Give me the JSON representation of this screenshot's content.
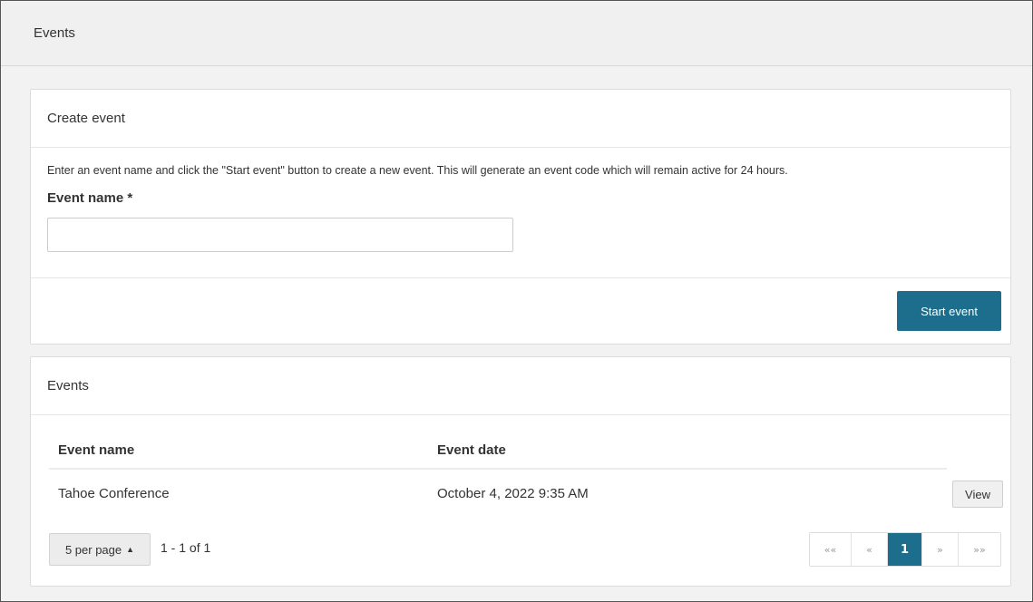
{
  "header": {
    "title": "Events"
  },
  "create_panel": {
    "title": "Create event",
    "description": "Enter an event name and click the \"Start event\" button to create a new event. This will generate an event code which will remain active for 24 hours.",
    "field_label": "Event name",
    "required_mark": "*",
    "input_value": "",
    "start_button": "Start event"
  },
  "events_panel": {
    "title": "Events",
    "columns": [
      "Event name",
      "Event date"
    ],
    "rows": [
      {
        "name": "Tahoe Conference",
        "date": "October 4, 2022 9:35 AM",
        "action": "View"
      }
    ],
    "per_page": "5 per page",
    "range": "1 - 1 of 1",
    "pagination": {
      "first": "««",
      "prev": "«",
      "current": "1",
      "next": "»",
      "last": "»»"
    }
  },
  "colors": {
    "primary": "#1c6e8c",
    "background": "#f2f2f2",
    "panel": "#ffffff"
  },
  "icons": {
    "per_page_caret": "caret-up-icon"
  }
}
